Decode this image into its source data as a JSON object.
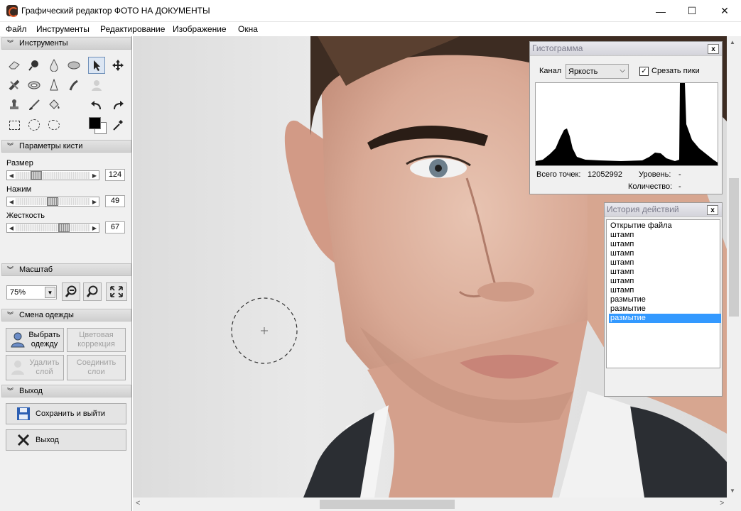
{
  "window": {
    "title": "Графический редактор ФОТО НА ДОКУМЕНТЫ",
    "minimize_glyph": "—",
    "maximize_glyph": "☐",
    "close_glyph": "✕"
  },
  "menu": [
    "Файл",
    "Инструменты",
    "Редактирование",
    "Изображение",
    "Окна"
  ],
  "sections": {
    "tools": "Инструменты",
    "brush": "Параметры кисти",
    "zoom": "Масштаб",
    "clothes": "Смена одежды",
    "exit": "Выход"
  },
  "brush_params": {
    "size": {
      "label": "Размер",
      "value": "124",
      "fraction": 0.24
    },
    "pressure": {
      "label": "Нажим",
      "value": "49",
      "fraction": 0.49
    },
    "hardness": {
      "label": "Жесткость",
      "value": "67",
      "fraction": 0.67
    }
  },
  "zoom": {
    "value": "75%",
    "arrow": "▼"
  },
  "clothes": {
    "choose": "Выбрать одежду",
    "color_correction": "Цветовая коррекция",
    "delete_layer": "Удалить слой",
    "merge_layers": "Соединить слои"
  },
  "exit_section": {
    "save_and_exit": "Сохранить и выйти",
    "exit": "Выход"
  },
  "histogram": {
    "title": "Гистограмма",
    "channel_label": "Канал",
    "channel_value": "Яркость",
    "clip_peaks_label": "Срезать пики",
    "clip_peaks_checked": true,
    "total_points_label": "Всего точек:",
    "total_points_value": "12052992",
    "level_label": "Уровень:",
    "level_value": "-",
    "count_label": "Количество:",
    "count_value": "-",
    "close": "x"
  },
  "history": {
    "title": "История действий",
    "close": "x",
    "items": [
      "Открытие файла",
      "штамп",
      "штамп",
      "штамп",
      "штамп",
      "штамп",
      "штамп",
      "штамп",
      "размытие",
      "размытие",
      "размытие"
    ],
    "selected_index": 10
  },
  "colors": {
    "accent_selection": "#3399ff",
    "foreground": "#000000",
    "background": "#ffffff"
  },
  "icons": {
    "scroll_up": "▲",
    "scroll_down": "▼",
    "scroll_left": "<",
    "scroll_right": ">",
    "section_chevron": "❯"
  }
}
